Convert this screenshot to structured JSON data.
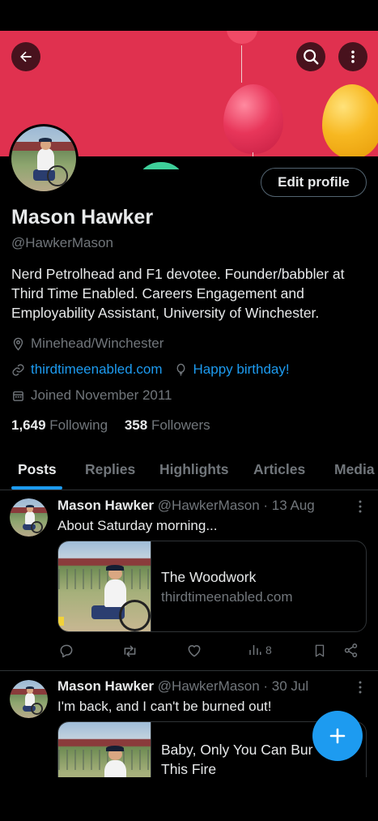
{
  "profile": {
    "name": "Mason Hawker",
    "handle": "@HawkerMason",
    "bio": "Nerd  Petrolhead and F1 devotee. Founder/babbler at Third Time Enabled. Careers Engagement and Employability Assistant, University of Winchester.",
    "location": "Minehead/Winchester",
    "website": "thirdtimeenabled.com",
    "birthday": "Happy birthday!",
    "joined": "Joined November 2011",
    "following_count": "1,649",
    "following_label": "Following",
    "followers_count": "358",
    "followers_label": "Followers",
    "edit_profile_label": "Edit profile"
  },
  "tabs": [
    {
      "label": "Posts"
    },
    {
      "label": "Replies"
    },
    {
      "label": "Highlights"
    },
    {
      "label": "Articles"
    },
    {
      "label": "Media"
    }
  ],
  "posts": [
    {
      "author": "Mason Hawker",
      "meta": "@HawkerMason · 13 Aug",
      "text": "About Saturday morning...",
      "card_title": "The Woodwork",
      "card_domain": "thirdtimeenabled.com",
      "views": "8"
    },
    {
      "author": "Mason Hawker",
      "meta": "@HawkerMason · 30 Jul",
      "text": "I'm back, and I can't be burned out!",
      "card_title_line1": "Baby, Only You Can Bur",
      "card_title_line2": "This Fire"
    }
  ],
  "icons": {
    "back": "arrow-left-icon",
    "search": "search-icon",
    "more": "more-vertical-icon",
    "location": "location-pin-icon",
    "link": "link-icon",
    "birthday": "balloon-icon",
    "calendar": "calendar-icon",
    "reply": "reply-icon",
    "repost": "repost-icon",
    "like": "heart-icon",
    "views": "views-icon",
    "bookmark": "bookmark-icon",
    "share": "share-icon",
    "compose": "plus-icon"
  },
  "colors": {
    "accent": "#1d9bf0",
    "banner": "#e0314f",
    "background": "#000000",
    "secondary_text": "#71767b"
  }
}
